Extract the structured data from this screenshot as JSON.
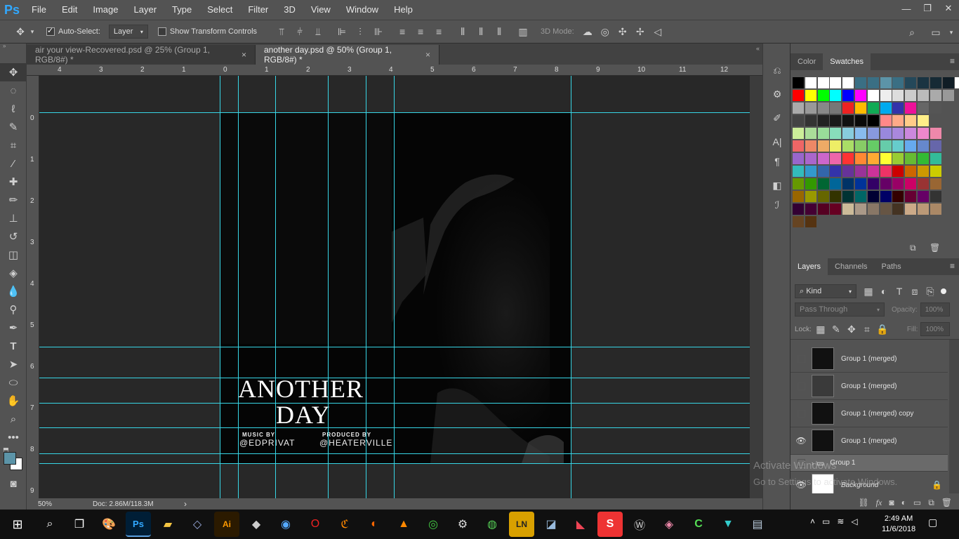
{
  "menubar": {
    "logo": "Ps",
    "items": [
      "File",
      "Edit",
      "Image",
      "Layer",
      "Type",
      "Select",
      "Filter",
      "3D",
      "View",
      "Window",
      "Help"
    ],
    "window_controls": [
      "—",
      "❐",
      "✕"
    ]
  },
  "options": {
    "auto_select_label": "Auto-Select:",
    "auto_select_value": "Layer",
    "transform_label": "Show Transform Controls",
    "mode_3d_label": "3D Mode:"
  },
  "tabs": [
    {
      "label": "air your view-Recovered.psd @ 25% (Group 1, RGB/8#) *",
      "close": "×"
    },
    {
      "label": "another day.psd @ 50% (Group 1, RGB/8#) *",
      "close": "×"
    }
  ],
  "ruler": {
    "top_labels": [
      "4",
      "3",
      "2",
      "1",
      "0",
      "1",
      "2",
      "3",
      "4",
      "5",
      "6",
      "7",
      "8",
      "9",
      "10",
      "11",
      "12"
    ],
    "left_labels": [
      "0",
      "1",
      "2",
      "3",
      "4",
      "5",
      "6",
      "7",
      "8",
      "9"
    ]
  },
  "poster": {
    "title_line1": "ANOTHER",
    "title_line2": "DAY",
    "music_label": "MUSIC BY",
    "music_handle": "@EDPRIVAT",
    "produced_label": "PRODUCED BY",
    "produced_handle": "@HEATERVILLE"
  },
  "status": {
    "zoom": "50%",
    "doc": "Doc: 2.86M/118.3M",
    "arrow": "›"
  },
  "color_panel": {
    "tabs": [
      "Color",
      "Swatches"
    ],
    "menu": "≡"
  },
  "layers_panel": {
    "tabs": [
      "Layers",
      "Channels",
      "Paths"
    ],
    "menu": "≡",
    "kind_label": "Kind",
    "blend_mode": "Pass Through",
    "opacity_label": "Opacity:",
    "opacity_value": "100%",
    "lock_label": "Lock:",
    "fill_label": "Fill:",
    "fill_value": "100%",
    "layers": [
      {
        "name": "Group 1 (merged)",
        "visible": false
      },
      {
        "name": "Group 1 (merged)",
        "visible": false
      },
      {
        "name": "Group 1 (merged) copy",
        "visible": false
      },
      {
        "name": "Group 1 (merged)",
        "visible": true
      },
      {
        "name": "Group 1",
        "visible": false
      },
      {
        "name": "Background",
        "visible": true
      }
    ],
    "footer_icons": [
      "link-icon",
      "fx-icon",
      "mask-icon",
      "adjustment-icon",
      "folder-icon",
      "new-layer-icon",
      "trash-icon"
    ]
  },
  "watermark": {
    "line1": "Activate Windows",
    "line2": "Go to Settings to activate Windows."
  },
  "taskbar": {
    "time": "2:49 AM",
    "date": "11/6/2018"
  },
  "colors": {
    "guide": "#37d6e6",
    "ps_blue": "#31a8ff",
    "panel": "#535353",
    "canvas_bg": "#282828"
  }
}
